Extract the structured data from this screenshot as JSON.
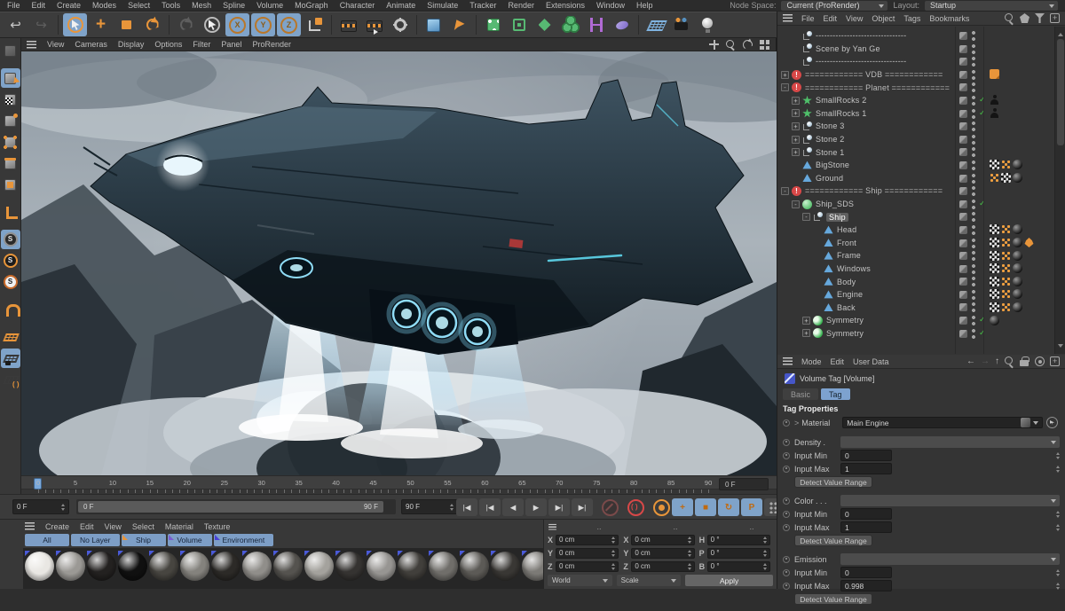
{
  "app": {
    "menus": [
      "File",
      "Edit",
      "Create",
      "Modes",
      "Select",
      "Tools",
      "Mesh",
      "Spline",
      "Volume",
      "MoGraph",
      "Character",
      "Animate",
      "Simulate",
      "Tracker",
      "Render",
      "Extensions",
      "Window",
      "Help"
    ],
    "node_space_label": "Node Space:",
    "node_space_value": "Current (ProRender)",
    "layout_label": "Layout:",
    "layout_value": "Startup"
  },
  "toolbar": {
    "buttons": [
      {
        "name": "undo",
        "kind": "glyph",
        "glyph": "↩",
        "color": "#c8c8c8"
      },
      {
        "name": "redo",
        "kind": "glyph",
        "glyph": "↪",
        "color": "#5e5e5e"
      },
      {
        "name": "live-selection",
        "kind": "select",
        "selected": true
      },
      {
        "name": "move",
        "kind": "move",
        "glyph": "+"
      },
      {
        "name": "scale",
        "kind": "scale"
      },
      {
        "name": "rotate",
        "kind": "rotate"
      },
      {
        "name": "last-tool",
        "kind": "rotdim"
      },
      {
        "name": "selection-tool",
        "kind": "select2"
      },
      {
        "name": "axis-x",
        "kind": "axis",
        "glyph": "X",
        "selected": true
      },
      {
        "name": "axis-y",
        "kind": "axis",
        "glyph": "Y",
        "selected": true
      },
      {
        "name": "axis-z",
        "kind": "axis",
        "glyph": "Z",
        "selected": true
      },
      {
        "name": "coordinate-system",
        "kind": "coord"
      },
      {
        "name": "render-view",
        "kind": "clap"
      },
      {
        "name": "render-to-picture-viewer",
        "kind": "clapplay"
      },
      {
        "name": "render-settings",
        "kind": "gear"
      },
      {
        "name": "add-cube",
        "kind": "cube"
      },
      {
        "name": "add-spline",
        "kind": "pen"
      },
      {
        "name": "add-generator",
        "kind": "gen"
      },
      {
        "name": "add-cage",
        "kind": "cage"
      },
      {
        "name": "add-deformer",
        "kind": "deform"
      },
      {
        "name": "add-volume",
        "kind": "volume"
      },
      {
        "name": "add-field",
        "kind": "field"
      },
      {
        "name": "add-blob",
        "kind": "blob"
      },
      {
        "name": "add-floor",
        "kind": "floor"
      },
      {
        "name": "add-camera",
        "kind": "camera"
      },
      {
        "name": "add-light",
        "kind": "light"
      }
    ]
  },
  "mode_toolbar": {
    "buttons": [
      {
        "name": "make-editable",
        "kind": "editable",
        "cube": true,
        "disabled": true
      },
      {
        "name": "model-mode",
        "kind": "model",
        "cube": true,
        "selected": true
      },
      {
        "name": "texture-mode",
        "kind": "texture",
        "cube": true
      },
      {
        "name": "workplane-mode",
        "kind": "cubedot",
        "cube": true
      },
      {
        "name": "points-mode",
        "kind": "cubepoints",
        "cube": true
      },
      {
        "name": "edges-mode",
        "kind": "cubeedges",
        "cube": true
      },
      {
        "name": "polygons-mode",
        "kind": "cubeface",
        "cube": true
      },
      {
        "name": "enable-axis",
        "kind": "axisl"
      },
      {
        "name": "snap-enable",
        "kind": "snapa",
        "snap": "S",
        "selected": true
      },
      {
        "name": "snap-modes",
        "kind": "snapb",
        "snap": "S"
      },
      {
        "name": "snap-settings",
        "kind": "snapc",
        "snap": "S"
      },
      {
        "name": "magnet",
        "kind": "magnet"
      },
      {
        "name": "workplane",
        "kind": "grida"
      },
      {
        "name": "lock-workplane",
        "kind": "gridb",
        "selected": true
      },
      {
        "name": "planar-workplane",
        "kind": "gridc"
      }
    ]
  },
  "viewport": {
    "menu": [
      "View",
      "Cameras",
      "Display",
      "Options",
      "Filter",
      "Panel",
      "ProRender"
    ],
    "view_icons": [
      "pan",
      "zoom",
      "rotate",
      "toggle"
    ]
  },
  "object_manager": {
    "menu": [
      "File",
      "Edit",
      "View",
      "Object",
      "Tags",
      "Bookmarks"
    ],
    "icons": [
      "search",
      "pent",
      "filter",
      "add"
    ],
    "items": [
      {
        "ind": 1,
        "icon": "null",
        "label": "--------------------------------"
      },
      {
        "ind": 1,
        "icon": "null",
        "label": "Scene by Yan Ge"
      },
      {
        "ind": 1,
        "icon": "null",
        "label": "--------------------------------"
      },
      {
        "ind": 0,
        "ex": "+",
        "icon": "alert",
        "label": "============ VDB ============",
        "hd": true,
        "tags": [
          "note"
        ]
      },
      {
        "ind": 0,
        "ex": "-",
        "icon": "alert",
        "label": "============ Planet ============",
        "hd": true
      },
      {
        "ind": 1,
        "ex": "+",
        "icon": "star",
        "label": "SmallRocks 2",
        "chk": true,
        "tags": [
          "figure"
        ]
      },
      {
        "ind": 1,
        "ex": "+",
        "icon": "star",
        "label": "SmallRocks 1",
        "chk": true,
        "tags": [
          "figure"
        ]
      },
      {
        "ind": 1,
        "ex": "+",
        "icon": "null",
        "label": "Stone 3"
      },
      {
        "ind": 1,
        "ex": "+",
        "icon": "null",
        "label": "Stone 2"
      },
      {
        "ind": 1,
        "ex": "+",
        "icon": "null",
        "label": "Stone 1"
      },
      {
        "ind": 1,
        "icon": "poly",
        "label": "BigStone",
        "tags": [
          "checker",
          "dots",
          "sphere"
        ]
      },
      {
        "ind": 1,
        "icon": "poly",
        "label": "Ground",
        "tags": [
          "dots",
          "checker",
          "sphere"
        ]
      },
      {
        "ind": 0,
        "ex": "-",
        "icon": "alert",
        "label": "============ Ship ============",
        "hd": true
      },
      {
        "ind": 1,
        "ex": "-",
        "icon": "sds",
        "label": "Ship_SDS",
        "chk": true
      },
      {
        "ind": 2,
        "ex": "-",
        "icon": "null",
        "label": "Ship",
        "sel": true
      },
      {
        "ind": 3,
        "icon": "poly",
        "label": "Head",
        "tags": [
          "checker",
          "dots",
          "sphere"
        ]
      },
      {
        "ind": 3,
        "icon": "poly",
        "label": "Front",
        "tags": [
          "checker",
          "dots",
          "sphere",
          "fire"
        ]
      },
      {
        "ind": 3,
        "icon": "poly",
        "label": "Frame",
        "tags": [
          "checker",
          "dots",
          "sphere"
        ]
      },
      {
        "ind": 3,
        "icon": "poly",
        "label": "Windows",
        "tags": [
          "checker",
          "dots",
          "sphere"
        ]
      },
      {
        "ind": 3,
        "icon": "poly",
        "label": "Body",
        "tags": [
          "checker",
          "dots",
          "sphere"
        ]
      },
      {
        "ind": 3,
        "icon": "poly",
        "label": "Engine",
        "tags": [
          "checker",
          "dots",
          "sphere"
        ]
      },
      {
        "ind": 3,
        "icon": "poly",
        "label": "Back",
        "tags": [
          "checker",
          "dots",
          "sphere"
        ]
      },
      {
        "ind": 2,
        "ex": "+",
        "icon": "sym",
        "label": "Symmetry",
        "chk": true,
        "tags": [
          "sphere"
        ]
      },
      {
        "ind": 2,
        "ex": "+",
        "icon": "sym",
        "label": "Symmetry",
        "chk": true
      }
    ]
  },
  "attribute_manager": {
    "menu": [
      "Mode",
      "Edit",
      "User Data"
    ],
    "icons": [
      "back",
      "forward",
      "up",
      "search",
      "lock",
      "target",
      "add"
    ],
    "title": "Volume Tag [Volume]",
    "tabs": [
      {
        "label": "Basic",
        "active": false
      },
      {
        "label": "Tag",
        "active": true
      }
    ],
    "section_title": "Tag Properties",
    "material_label": "Material",
    "material_value": "Main Engine",
    "groups": [
      {
        "label": "Density .",
        "rows": [
          {
            "label": "Input Min",
            "value": "0"
          },
          {
            "label": "Input Max",
            "value": "1"
          }
        ],
        "button": "Detect Value Range"
      },
      {
        "label": "Color . . .",
        "rows": [
          {
            "label": "Input Min",
            "value": "0"
          },
          {
            "label": "Input Max",
            "value": "1"
          }
        ],
        "button": "Detect Value Range"
      },
      {
        "label": "Emission",
        "rows": [
          {
            "label": "Input Min",
            "value": "0"
          },
          {
            "label": "Input Max",
            "value": "0.998"
          }
        ],
        "button": "Detect Value Range"
      }
    ]
  },
  "timeline": {
    "min": 0,
    "max": 90,
    "label_step": 5,
    "playhead": 0,
    "frame_box": "0 F"
  },
  "transport": {
    "current": "0 F",
    "range_start": "0 F",
    "range_end": "90 F",
    "end": "90 F",
    "buttons": [
      {
        "name": "goto-start",
        "glyph": "|◀"
      },
      {
        "name": "prev-key",
        "glyph": "|◀"
      },
      {
        "name": "prev-frame",
        "glyph": "◀"
      },
      {
        "name": "play",
        "glyph": "▶"
      },
      {
        "name": "next-frame",
        "glyph": "▶|"
      },
      {
        "name": "goto-end",
        "glyph": "▶|"
      }
    ],
    "extra_buttons": [
      {
        "name": "play-sound",
        "kind": "mute"
      },
      {
        "name": "loop-record",
        "kind": "loop"
      },
      {
        "name": "autokey",
        "kind": "key"
      },
      {
        "name": "key-position",
        "kind": "blue",
        "glyph": "+"
      },
      {
        "name": "key-scale",
        "kind": "blue",
        "glyph": "■"
      },
      {
        "name": "key-rotation",
        "kind": "blue",
        "glyph": "↻"
      },
      {
        "name": "key-parameter",
        "kind": "blue",
        "glyph": "P"
      },
      {
        "name": "key-pla",
        "kind": "pla"
      },
      {
        "name": "keyframe-selection",
        "kind": "film"
      }
    ]
  },
  "material_manager": {
    "menu": [
      "Create",
      "Edit",
      "View",
      "Select",
      "Material",
      "Texture"
    ],
    "layer_tabs": [
      {
        "label": "All"
      },
      {
        "label": "No Layer"
      },
      {
        "label": "Ship",
        "corner": "#e8953a"
      },
      {
        "label": "Volume",
        "corner": "#7a5cd0"
      },
      {
        "label": "Environment",
        "corner": "#4940d8"
      }
    ],
    "swatches": [
      "#e9e7e3",
      "#9b9995",
      "#232120",
      "#101010",
      "#474540",
      "#84827d",
      "#2c2a27",
      "#908e8a",
      "#55534f",
      "#a4a29d",
      "#353331",
      "#979592",
      "#413f3b",
      "#706e6a",
      "#5c5a56",
      "#393734",
      "#7c7a76",
      "#666460"
    ]
  },
  "coordinates": {
    "headers": [
      "..",
      "..",
      ".."
    ],
    "rows": [
      [
        {
          "l": "X",
          "v": "0 cm"
        },
        {
          "l": "X",
          "v": "0 cm"
        },
        {
          "l": "H",
          "v": "0 °"
        }
      ],
      [
        {
          "l": "Y",
          "v": "0 cm"
        },
        {
          "l": "Y",
          "v": "0 cm"
        },
        {
          "l": "P",
          "v": "0 °"
        }
      ],
      [
        {
          "l": "Z",
          "v": "0 cm"
        },
        {
          "l": "Z",
          "v": "0 cm"
        },
        {
          "l": "B",
          "v": "0 °"
        }
      ]
    ],
    "space": "World",
    "mode": "Scale",
    "apply": "Apply"
  }
}
